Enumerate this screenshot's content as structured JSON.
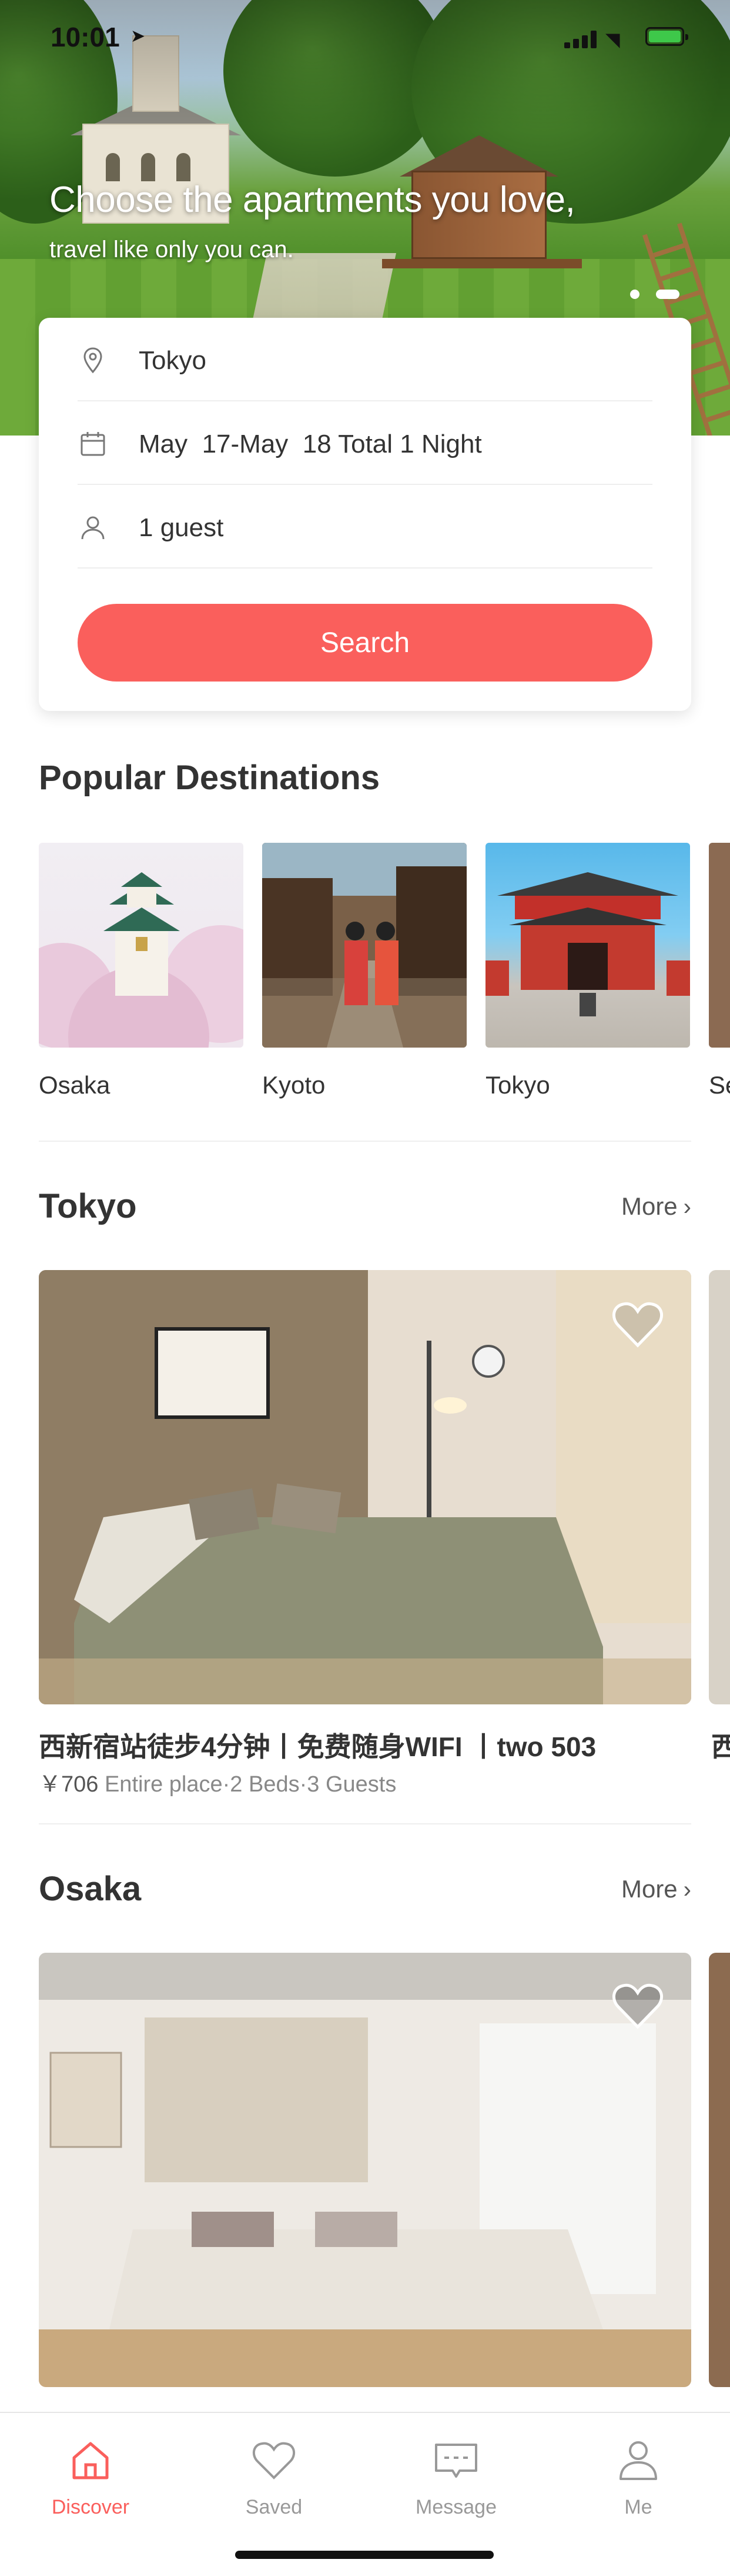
{
  "status_bar": {
    "time": "10:01"
  },
  "hero": {
    "title": "Choose the apartments you love,",
    "subtitle": "travel like only you can."
  },
  "search": {
    "location": "Tokyo",
    "dates": "May  17-May  18 Total 1 Night",
    "guests": "1 guest",
    "button": "Search",
    "icons": {
      "location": "location-pin-icon",
      "dates": "calendar-icon",
      "guests": "person-icon"
    }
  },
  "popular": {
    "title": "Popular Destinations",
    "items": [
      {
        "name": "Osaka"
      },
      {
        "name": "Kyoto"
      },
      {
        "name": "Tokyo"
      },
      {
        "name": "Se"
      }
    ]
  },
  "tokyo_section": {
    "title": "Tokyo",
    "more": "More",
    "listing": {
      "title": "西新宿站徒步4分钟丨免费随身WIFI 丨two 503",
      "price": "￥706",
      "details": " Entire place·2 Beds·3 Guests",
      "peek_title": "西"
    }
  },
  "osaka_section": {
    "title": "Osaka",
    "more": "More"
  },
  "tabbar": {
    "items": [
      {
        "label": "Discover",
        "icon": "home-icon",
        "active": true
      },
      {
        "label": "Saved",
        "icon": "heart-icon",
        "active": false
      },
      {
        "label": "Message",
        "icon": "message-icon",
        "active": false
      },
      {
        "label": "Me",
        "icon": "person-icon",
        "active": false
      }
    ]
  },
  "colors": {
    "accent": "#fa5f5c",
    "text": "#333333",
    "muted": "#888888"
  }
}
